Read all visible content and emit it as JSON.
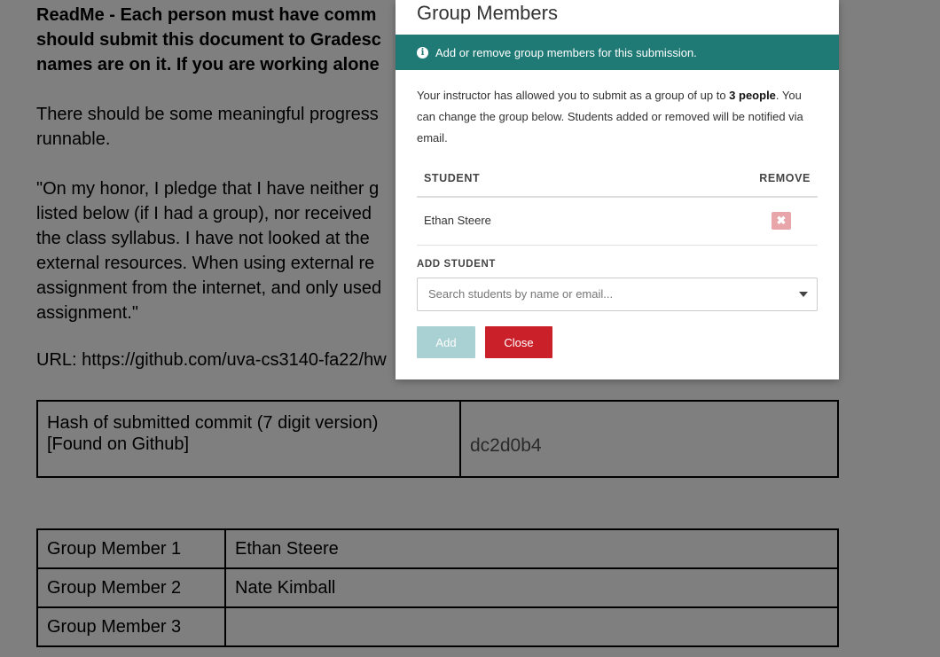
{
  "document": {
    "readme_lines": [
      "ReadMe - Each person must have comm",
      "should submit this document to Gradesc",
      "names are on it. If you are working alone"
    ],
    "progress_lines": [
      "There should be some meaningful progress",
      "runnable."
    ],
    "honor_lines": [
      "\"On my honor, I pledge that I have neither g",
      "listed below (if I had a group), nor received",
      "the class syllabus. I have not looked at the",
      "external resources. When using external re",
      "assignment from the internet, and only used",
      "assignment.\""
    ],
    "url_text": "URL: https://github.com/uva-cs3140-fa22/hw",
    "hash_label_line1": "Hash of submitted commit (7 digit version)",
    "hash_label_line2": "[Found on Github]",
    "hash_value": "dc2d0b4",
    "members": [
      {
        "label": "Group Member 1",
        "name": "Ethan Steere"
      },
      {
        "label": "Group Member 2",
        "name": "Nate Kimball"
      },
      {
        "label": "Group Member 3",
        "name": ""
      }
    ]
  },
  "modal": {
    "title": "Group Members",
    "banner_text": "Add or remove group members for this submission.",
    "info_icon_glyph": "i",
    "description_prefix": "Your instructor has allowed you to submit as a group of up to ",
    "description_bold": "3 people",
    "description_suffix": ". You can change the group below. Students added or removed will be notified via email.",
    "col_student": "STUDENT",
    "col_remove": "REMOVE",
    "students": [
      {
        "name": "Ethan Steere"
      }
    ],
    "remove_icon_glyph": "✖",
    "add_student_label": "ADD STUDENT",
    "search_placeholder": "Search students by name or email...",
    "add_button": "Add",
    "close_button": "Close"
  },
  "colors": {
    "banner": "#1f7a75",
    "close_button": "#c9202a",
    "add_button_disabled": "#a9d0d2",
    "remove_button": "#e8a5aa"
  }
}
